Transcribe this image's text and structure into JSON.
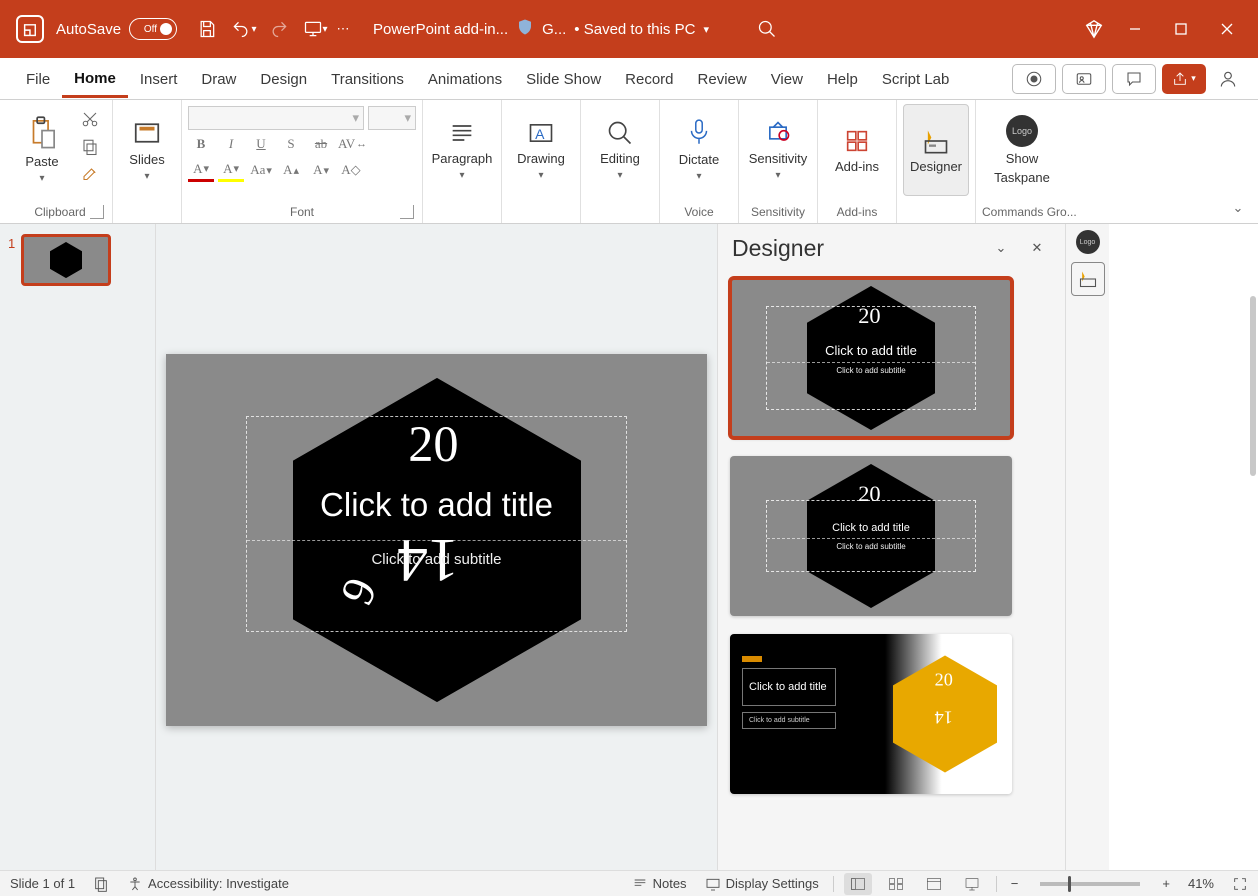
{
  "titlebar": {
    "autosave_label": "AutoSave",
    "autosave_state": "Off",
    "addin_text": "PowerPoint add-in...",
    "doc_badge": "G...",
    "saved_text": "• Saved to this PC"
  },
  "tabs": {
    "items": [
      "File",
      "Home",
      "Insert",
      "Draw",
      "Design",
      "Transitions",
      "Animations",
      "Slide Show",
      "Record",
      "Review",
      "View",
      "Help",
      "Script Lab"
    ],
    "active": "Home"
  },
  "ribbon": {
    "clipboard": {
      "paste": "Paste",
      "label": "Clipboard"
    },
    "slides": {
      "btn": "Slides"
    },
    "font": {
      "label": "Font"
    },
    "paragraph": {
      "btn": "Paragraph"
    },
    "drawing": {
      "btn": "Drawing"
    },
    "editing": {
      "btn": "Editing"
    },
    "dictate": {
      "btn": "Dictate",
      "label": "Voice"
    },
    "sensitivity": {
      "btn": "Sensitivity",
      "label": "Sensitivity"
    },
    "addins": {
      "btn": "Add-ins",
      "label": "Add-ins"
    },
    "designer": {
      "btn": "Designer"
    },
    "taskpane": {
      "btn1": "Show",
      "btn2": "Taskpane",
      "label": "Commands Gro..."
    }
  },
  "thumbnails": {
    "items": [
      {
        "num": "1"
      }
    ]
  },
  "slide": {
    "title_placeholder": "Click to add title",
    "subtitle_placeholder": "Click to add subtitle"
  },
  "designer_pane": {
    "title": "Designer",
    "card_title": "Click to add title",
    "card_subtitle": "Click to add subtitle"
  },
  "statusbar": {
    "slide_info": "Slide 1 of 1",
    "accessibility": "Accessibility: Investigate",
    "notes": "Notes",
    "display": "Display Settings",
    "zoom": "41%"
  }
}
